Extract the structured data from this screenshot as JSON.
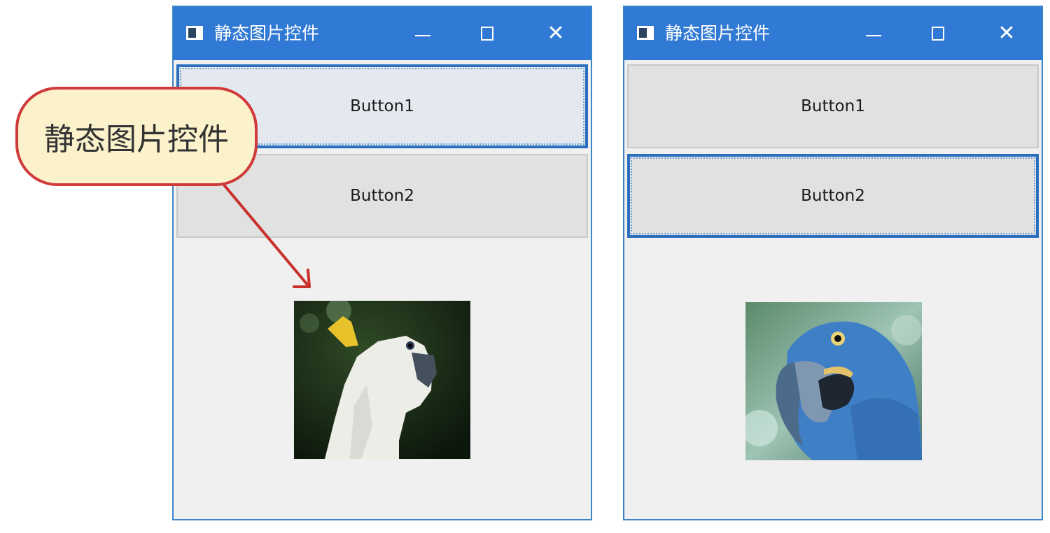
{
  "windows": [
    {
      "title": "静态图片控件",
      "button1_label": "Button1",
      "button2_label": "Button2",
      "focused_button": "button1",
      "image": "cockatoo"
    },
    {
      "title": "静态图片控件",
      "button1_label": "Button1",
      "button2_label": "Button2",
      "focused_button": "button2",
      "image": "blue-macaw"
    }
  ],
  "callout": {
    "text": "静态图片控件",
    "border_color": "#d03a3a",
    "fill_color": "#fbf2cb"
  },
  "colors": {
    "titlebar": "#3079d4",
    "window_background": "#f0f0f0",
    "button_background": "#e1e1e1",
    "focus_border": "#2a6fbf"
  },
  "icons": [
    "window-app-icon",
    "minimize-icon",
    "maximize-icon",
    "close-icon",
    "callout-arrow"
  ]
}
